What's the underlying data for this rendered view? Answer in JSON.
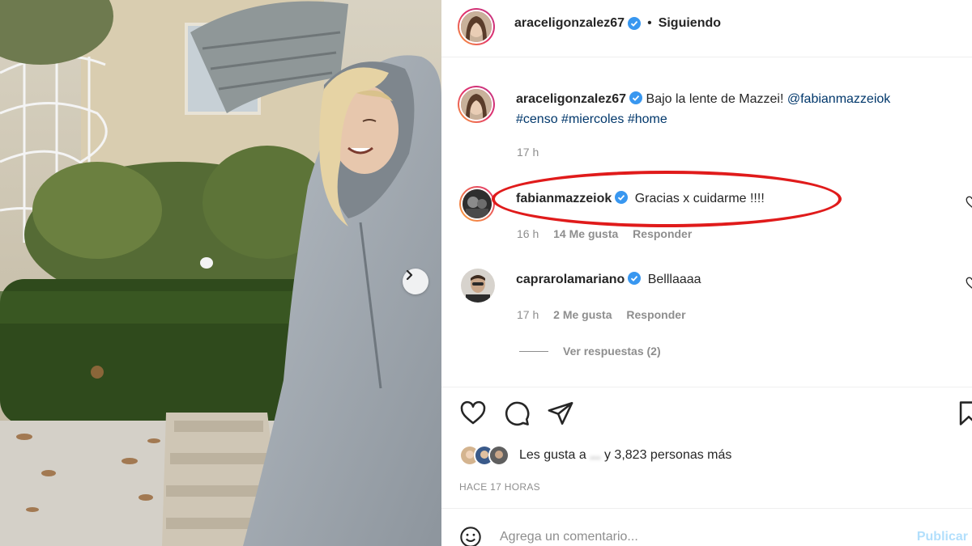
{
  "post": {
    "author": "araceligonzalez67",
    "follow_state": "Siguiendo",
    "separator": "•"
  },
  "caption": {
    "author": "araceligonzalez67",
    "text": "Bajo la lente de Mazzei!",
    "mention": "@fabianmazzeiok",
    "hashtags": "#censo #miercoles #home",
    "time": "17 h"
  },
  "comments": [
    {
      "author": "fabianmazzeiok",
      "text": "Gracias x cuidarme !!!!",
      "time": "16 h",
      "likes": "14 Me gusta",
      "reply": "Responder"
    },
    {
      "author": "caprarolamariano",
      "text": "Belllaaaa",
      "time": "17 h",
      "likes": "2 Me gusta",
      "reply": "Responder"
    }
  ],
  "view_replies": "Ver respuestas (2)",
  "likes": {
    "prefix": "Les gusta a",
    "blurred_name": "...",
    "suffix": "y 3,823 personas más"
  },
  "time_ago": "HACE 17 HORAS",
  "add_comment": {
    "placeholder": "Agrega un comentario...",
    "publish": "Publicar"
  },
  "colors": {
    "verified": "#3897f0",
    "link": "#00376b",
    "highlight": "#e01b1b",
    "publish_disabled": "#b2dffc"
  },
  "icons": [
    "chevron-right-icon",
    "verified-badge-icon",
    "heart-icon",
    "comment-icon",
    "share-icon",
    "bookmark-icon",
    "emoji-icon"
  ]
}
